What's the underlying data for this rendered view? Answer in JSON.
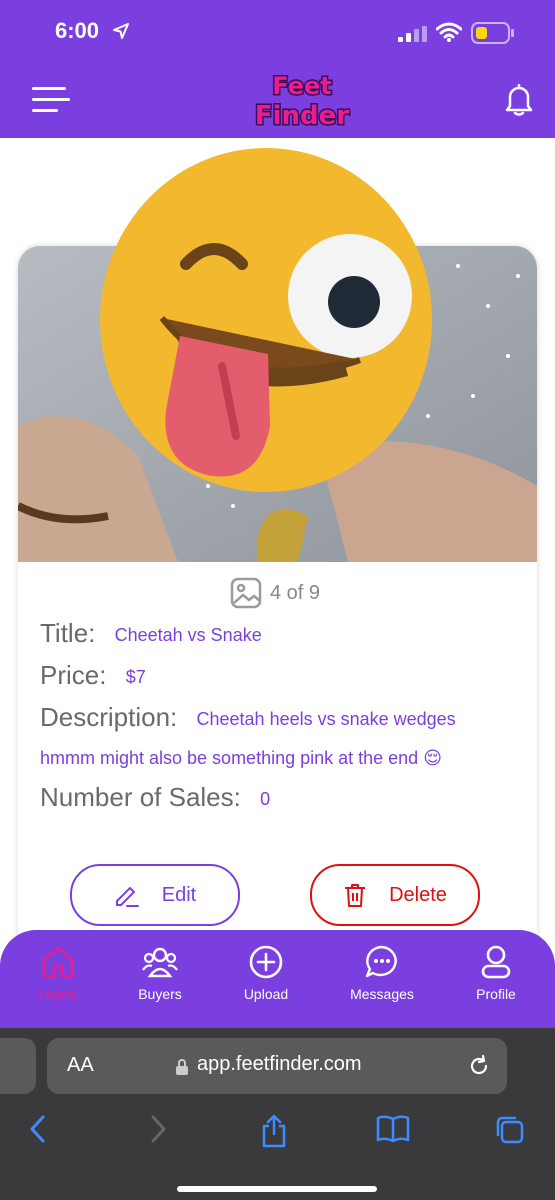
{
  "status_bar": {
    "time": "6:00"
  },
  "header": {
    "logo_line1": "Feet",
    "logo_line2": "Finder"
  },
  "image_counter": "4 of 9",
  "listing": {
    "title_label": "Title:",
    "title": "Cheetah vs Snake",
    "price_label": "Price:",
    "price": "$7",
    "description_label": "Description:",
    "description_line1": "Cheetah heels vs snake wedges",
    "description_line2": "hmmm might also be something pink at the end 😌",
    "sales_label": "Number of Sales:",
    "sales": "0"
  },
  "actions": {
    "edit": "Edit",
    "delete": "Delete"
  },
  "nav": {
    "items": [
      {
        "label": "Home",
        "icon": "home-icon",
        "active": true
      },
      {
        "label": "Buyers",
        "icon": "users-icon"
      },
      {
        "label": "Upload",
        "icon": "plus-circle-icon"
      },
      {
        "label": "Messages",
        "icon": "chat-icon"
      },
      {
        "label": "Profile",
        "icon": "user-icon"
      }
    ]
  },
  "browser": {
    "aa": "AA",
    "url": "app.feetfinder.com"
  },
  "colors": {
    "brand": "#7b3fe0",
    "accent_pink": "#e91e8c",
    "delete_red": "#e01010"
  }
}
